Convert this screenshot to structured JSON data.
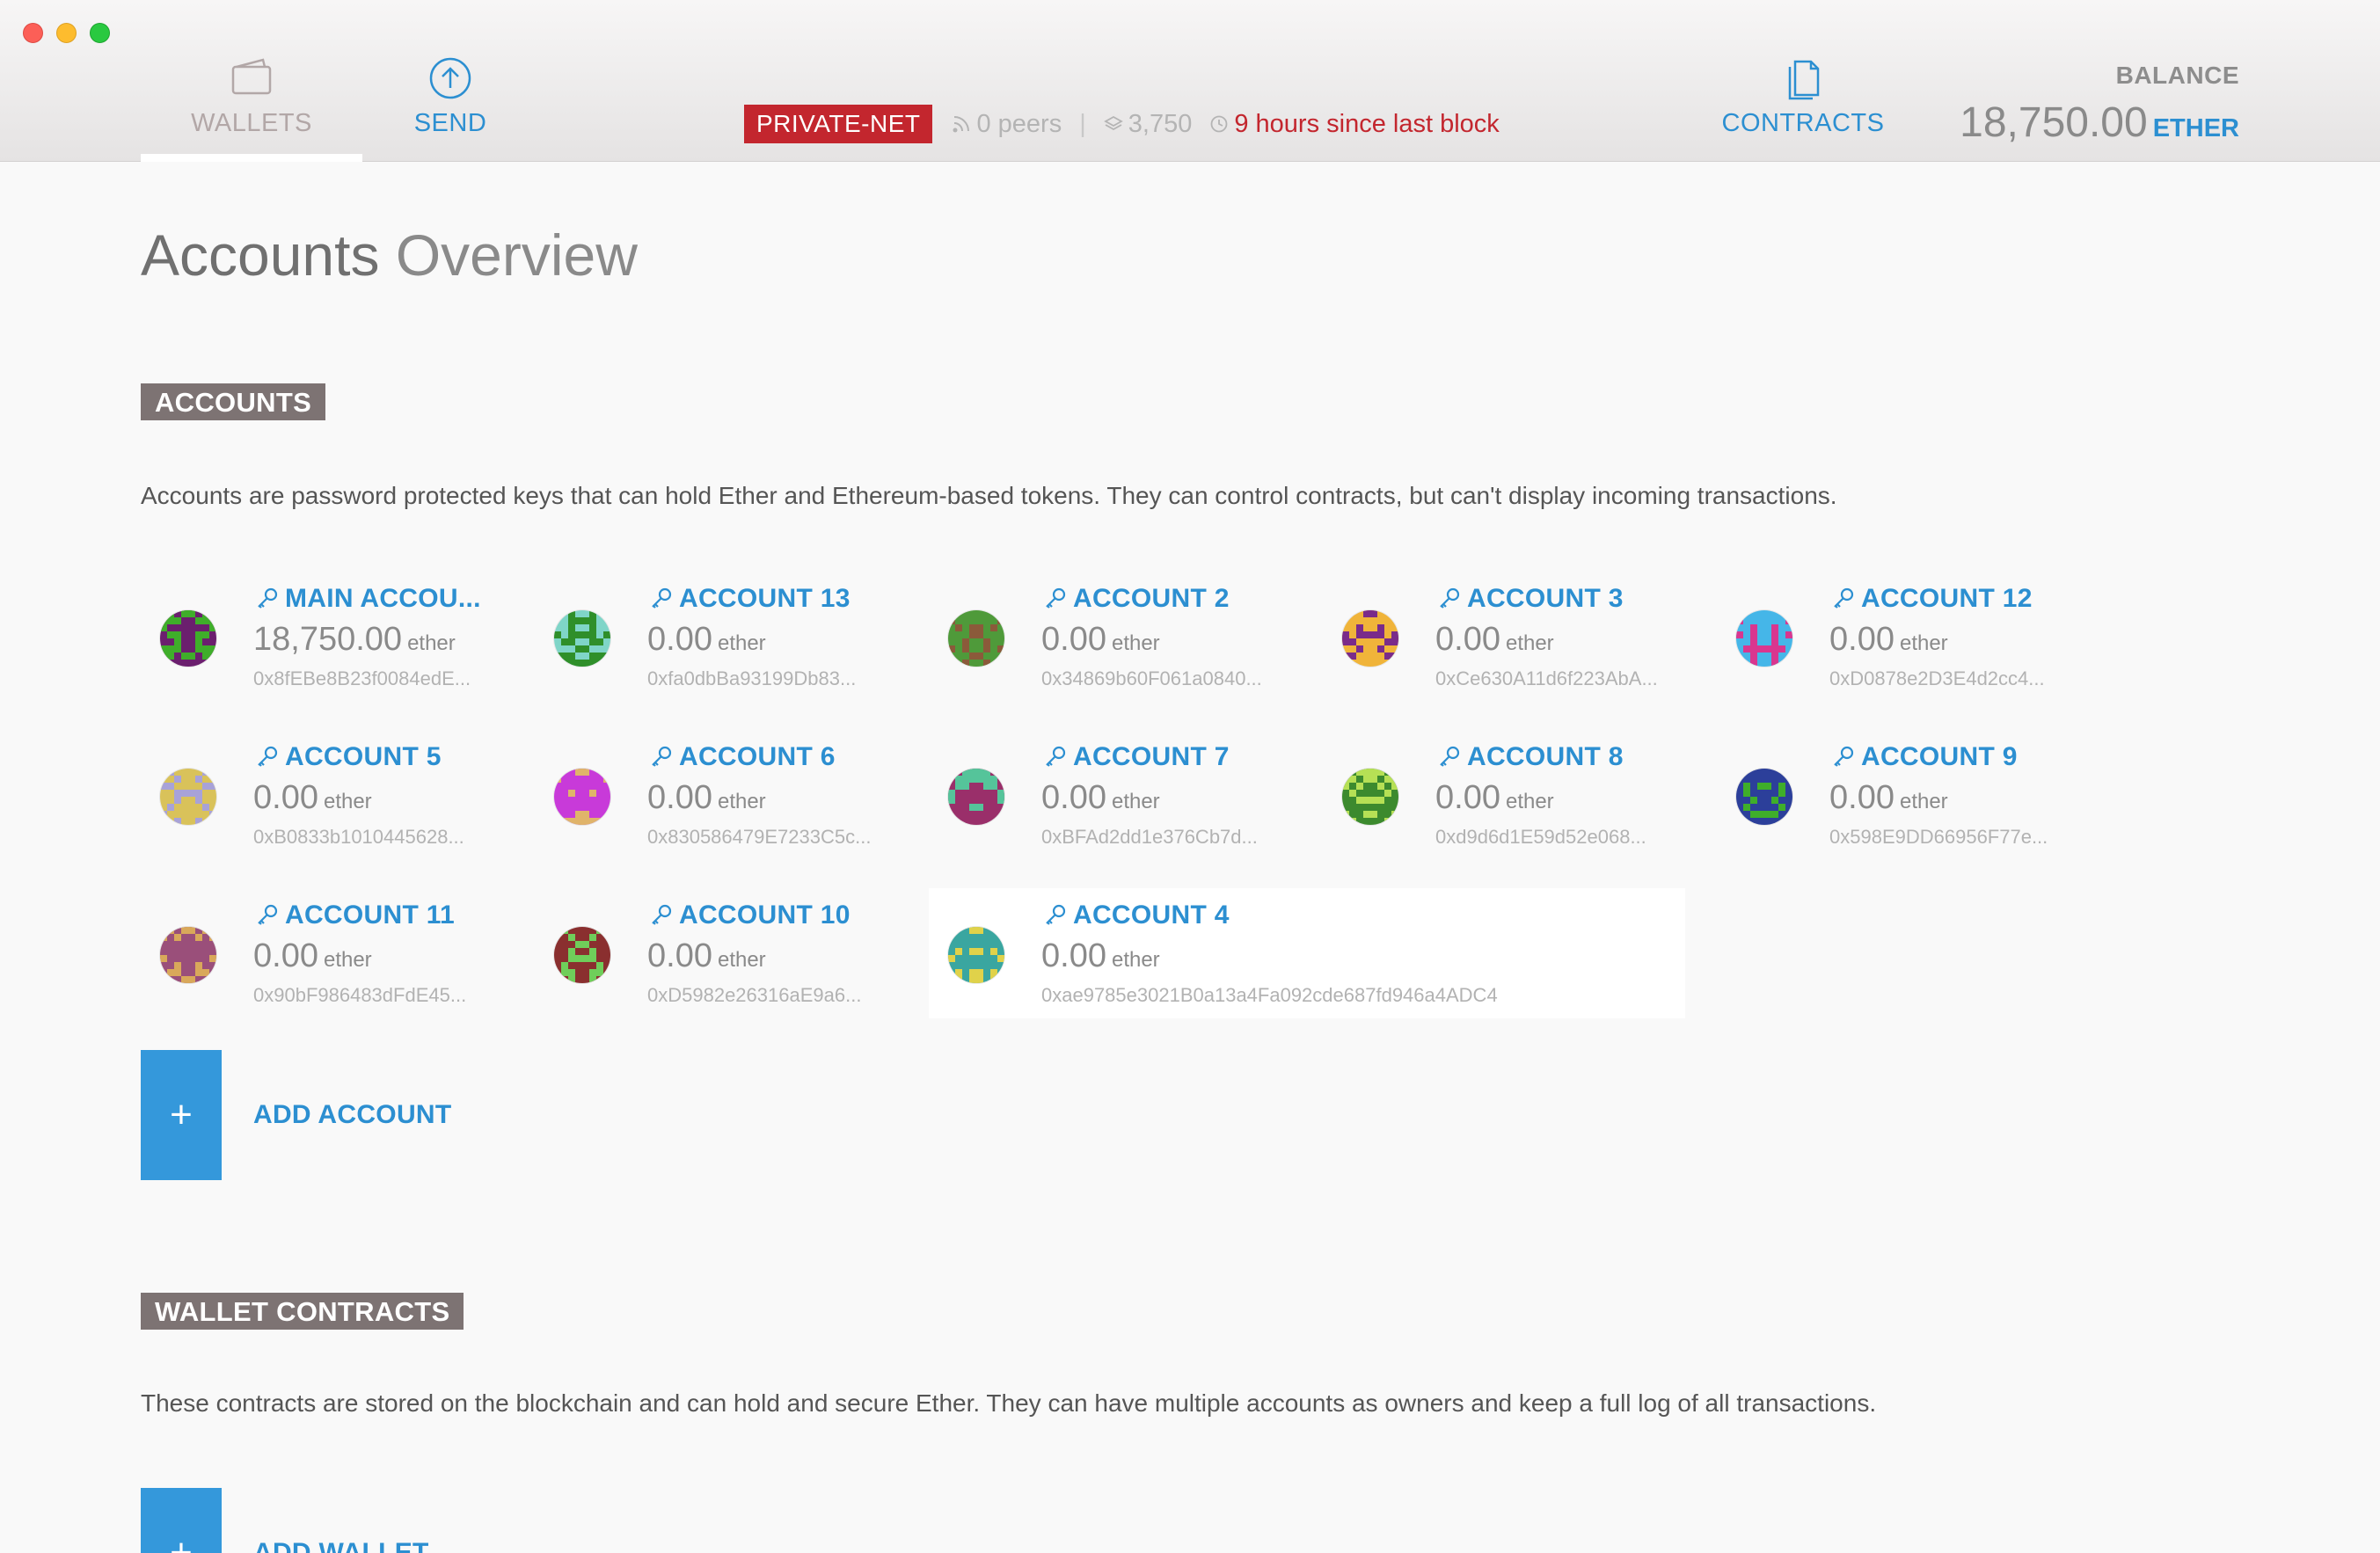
{
  "nav": {
    "wallets_label": "WALLETS",
    "send_label": "SEND",
    "contracts_label": "CONTRACTS"
  },
  "status": {
    "network": "PRIVATE-NET",
    "peers": "0 peers",
    "block": "3,750",
    "last_block": "9 hours since last block"
  },
  "balance": {
    "label": "BALANCE",
    "value": "18,750.00",
    "unit": "ETHER"
  },
  "page": {
    "title_bold": "Accounts",
    "title_light": "Overview"
  },
  "accounts_section": {
    "tag": "ACCOUNTS",
    "description": "Accounts are password protected keys that can hold Ether and Ethereum-based tokens. They can control contracts, but can't display incoming transactions.",
    "add_label": "ADD ACCOUNT",
    "add_icon": "+"
  },
  "wallets_section": {
    "tag": "WALLET CONTRACTS",
    "description": "These contracts are stored on the blockchain and can hold and secure Ether. They can have multiple accounts as owners and keep a full log of all transactions.",
    "add_label": "ADD WALLET",
    "add_icon": "+"
  },
  "accounts": [
    {
      "name": "MAIN ACCOU...",
      "balance": "18,750.00",
      "unit": "ether",
      "address": "0x8fEBe8B23f0084edE...",
      "colors": [
        "#6b1f6e",
        "#3fae2a"
      ]
    },
    {
      "name": "ACCOUNT 13",
      "balance": "0.00",
      "unit": "ether",
      "address": "0xfa0dbBa93199Db83...",
      "colors": [
        "#7fd5c8",
        "#2f8f2a"
      ]
    },
    {
      "name": "ACCOUNT 2",
      "balance": "0.00",
      "unit": "ether",
      "address": "0x34869b60F061a0840...",
      "colors": [
        "#4f9a3a",
        "#8b5a3a"
      ]
    },
    {
      "name": "ACCOUNT 3",
      "balance": "0.00",
      "unit": "ether",
      "address": "0xCe630A11d6f223AbA...",
      "colors": [
        "#f0b43a",
        "#7a2b8a"
      ]
    },
    {
      "name": "ACCOUNT 12",
      "balance": "0.00",
      "unit": "ether",
      "address": "0xD0878e2D3E4d2cc4...",
      "colors": [
        "#45b6e8",
        "#d9368f"
      ]
    },
    {
      "name": "ACCOUNT 5",
      "balance": "0.00",
      "unit": "ether",
      "address": "0xB0833b1010445628...",
      "colors": [
        "#d9c25a",
        "#a8a2d8"
      ]
    },
    {
      "name": "ACCOUNT 6",
      "balance": "0.00",
      "unit": "ether",
      "address": "0x830586479E7233C5c...",
      "colors": [
        "#c83ad9",
        "#e0b46a"
      ]
    },
    {
      "name": "ACCOUNT 7",
      "balance": "0.00",
      "unit": "ether",
      "address": "0xBFAd2dd1e376Cb7d...",
      "colors": [
        "#9a2f6a",
        "#55c49a"
      ]
    },
    {
      "name": "ACCOUNT 8",
      "balance": "0.00",
      "unit": "ether",
      "address": "0xd9d6d1E59d52e068...",
      "colors": [
        "#3c8a2e",
        "#b6e055"
      ]
    },
    {
      "name": "ACCOUNT 9",
      "balance": "0.00",
      "unit": "ether",
      "address": "0x598E9DD66956F77e...",
      "colors": [
        "#2c3f9a",
        "#3fae2a"
      ]
    },
    {
      "name": "ACCOUNT 11",
      "balance": "0.00",
      "unit": "ether",
      "address": "0x90bF986483dFdE45...",
      "colors": [
        "#9a4f7a",
        "#d9a85a"
      ]
    },
    {
      "name": "ACCOUNT 10",
      "balance": "0.00",
      "unit": "ether",
      "address": "0xD5982e26316aE9a6...",
      "colors": [
        "#8a2f2f",
        "#6fce5a"
      ]
    },
    {
      "name": "ACCOUNT 4",
      "balance": "0.00",
      "unit": "ether",
      "address": "0xae9785e3021B0a13a4Fa092cde687fd946a4ADC4",
      "colors": [
        "#3aa6a0",
        "#e0d24a"
      ]
    }
  ],
  "colors": {
    "accent": "#2c8fd1",
    "network_badge": "#c3262e",
    "section_tag": "#7d7373",
    "add_button": "#3498db"
  },
  "icons": {
    "wallets": "wallet-icon",
    "send": "arrow-up-circle-icon",
    "contracts": "documents-icon",
    "account": "key-icon"
  }
}
